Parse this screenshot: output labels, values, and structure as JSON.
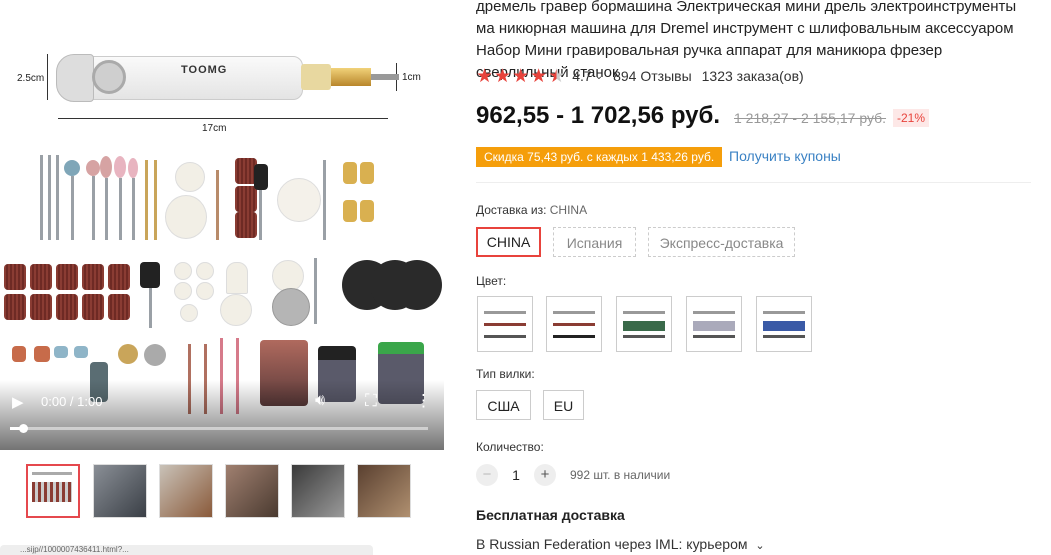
{
  "video": {
    "time": "0:00 / 1:00",
    "progress": 0.03,
    "dim_height": "2.5cm",
    "dim_tip": "1cm",
    "dim_length": "17cm",
    "logo": "TOOMG"
  },
  "thumbnails": [
    "thumb-1",
    "thumb-2",
    "thumb-3",
    "thumb-4",
    "thumb-5",
    "thumb-6"
  ],
  "url_text": "...sijp//1000007436411.html?...",
  "product": {
    "title": "дремель гравер бормашина Электрическая мини дрель электроинструменты ма никюрная машина для Dremel инструмент с шлифовальным аксессуаром Набор Мини гравировальная ручка аппарат для маникюра фрезер сверлильный станок",
    "rating": "4.7",
    "reviews": "894 Отзывы",
    "orders": "1323 заказа(ов)",
    "price": "962,55 - 1 702,56 руб.",
    "old_price": "1 218,27 - 2 155,17 руб.",
    "discount": "-21%",
    "coupon_text": "Скидка 75,43 руб. с каждых 1 433,26 руб.",
    "get_coupons": "Получить купоны"
  },
  "shipping_from": {
    "label": "Доставка из:",
    "value": "CHINA",
    "options": [
      "CHINA",
      "Испания",
      "Экспресс-доставка"
    ]
  },
  "color": {
    "label": "Цвет:"
  },
  "plug": {
    "label": "Тип вилки:",
    "options": [
      "США",
      "EU"
    ]
  },
  "quantity": {
    "label": "Количество:",
    "value": "1",
    "minus": "−",
    "plus": "+",
    "stock": "992 шт. в наличии"
  },
  "delivery": {
    "title": "Бесплатная доставка",
    "info": "В Russian Federation через IML: курьером"
  },
  "colors": {
    "accent": "#e8433c",
    "coupon": "#f59e0b",
    "link": "#3b82c4"
  }
}
